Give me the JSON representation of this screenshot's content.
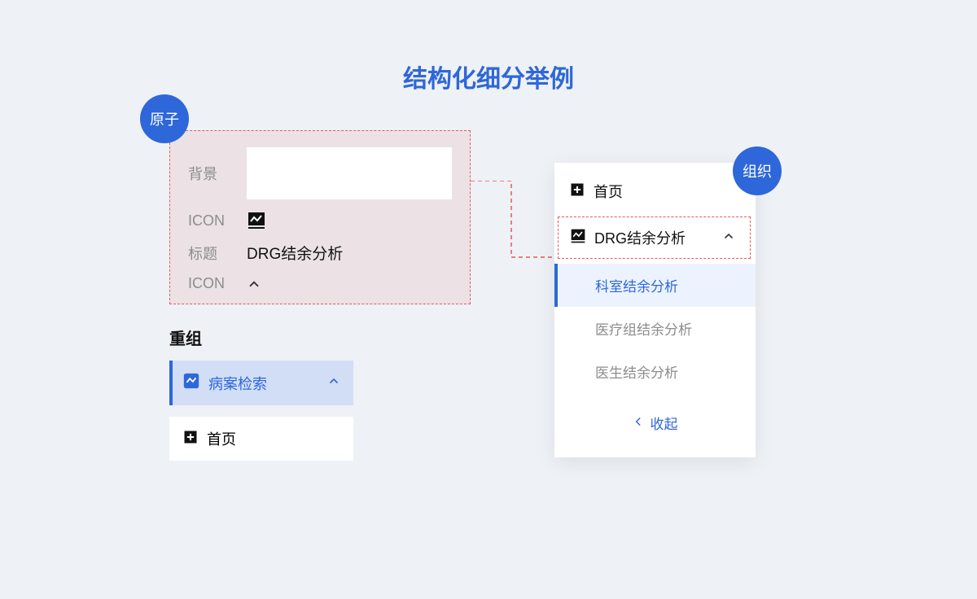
{
  "title": "结构化细分举例",
  "badges": {
    "atom": "原子",
    "organization": "组织"
  },
  "atom": {
    "background_label": "背景",
    "icon_label": "ICON",
    "title_label": "标题",
    "title_value": "DRG结余分析",
    "icon2_label": "ICON"
  },
  "recombine": {
    "heading": "重组",
    "item1": "病案检索",
    "item2": "首页"
  },
  "org": {
    "home": "首页",
    "drg": "DRG结余分析",
    "sub1": "科室结余分析",
    "sub2": "医疗组结余分析",
    "sub3": "医生结余分析",
    "collapse": "收起"
  }
}
